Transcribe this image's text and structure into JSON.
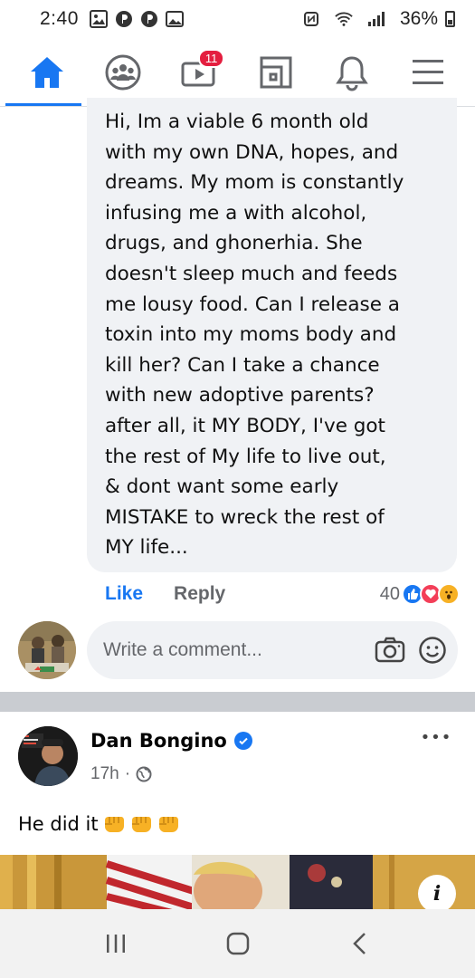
{
  "status_bar": {
    "time": "2:40",
    "battery": "36%",
    "left_icons": [
      "photo-gallery-icon",
      "pandora-icon",
      "pandora-icon",
      "image-icon"
    ],
    "right_icons": [
      "nfc-icon",
      "wifi-icon",
      "signal-icon",
      "battery-icon"
    ]
  },
  "nav": {
    "items": [
      {
        "name": "home",
        "icon": "home-icon",
        "active": true
      },
      {
        "name": "groups",
        "icon": "groups-icon"
      },
      {
        "name": "watch",
        "icon": "watch-icon",
        "badge": "11"
      },
      {
        "name": "pages",
        "icon": "pages-icon"
      },
      {
        "name": "notifications",
        "icon": "bell-icon"
      },
      {
        "name": "menu",
        "icon": "hamburger-menu-icon"
      }
    ],
    "accent": "#1877f2"
  },
  "comment": {
    "text": "Hi, Im a viable 6 month old\nwith my own DNA, hopes, and\ndreams. My mom is constantly\ninfusing me a with alcohol,\ndrugs, and ghonerhia. She\ndoesn't sleep much and feeds\nme lousy food. Can I release a\ntoxin into my moms body and\nkill her? Can I take a chance\nwith new adoptive parents?\nafter all, it MY BODY, I've got\nthe rest of My life to live out,\n& dont want some early\nMISTAKE to wreck the rest of\nMY life...",
    "like_label": "Like",
    "reply_label": "Reply",
    "reaction_count": "40",
    "reactions": [
      "like",
      "love",
      "wow"
    ]
  },
  "write_comment": {
    "placeholder": "Write a comment..."
  },
  "post": {
    "author": "Dan Bongino",
    "verified": true,
    "time": "17h",
    "privacy": "public",
    "text": "He did it",
    "emoji_count": 3,
    "more_label": "•••"
  },
  "system_nav": {
    "recents": "recents-icon",
    "home": "home-button-icon",
    "back": "back-icon"
  }
}
